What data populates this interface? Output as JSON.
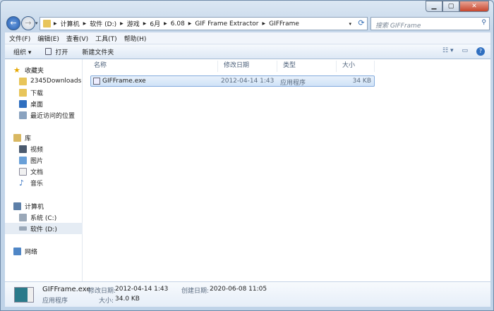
{
  "address": {
    "crumbs": [
      "计算机",
      "软件 (D:)",
      "游戏",
      "6月",
      "6.08",
      "GIF Frame Extractor",
      "GIFFrame"
    ]
  },
  "search": {
    "placeholder": "搜索 GIFFrame"
  },
  "menu": [
    "文件(F)",
    "编辑(E)",
    "查看(V)",
    "工具(T)",
    "帮助(H)"
  ],
  "toolbar": {
    "organize": "组织 ▾",
    "open": "打开",
    "new_folder": "新建文件夹"
  },
  "sidebar": {
    "favorites": "收藏夹",
    "fav_items": [
      "2345Downloads",
      "下载",
      "桌面",
      "最近访问的位置"
    ],
    "libraries": "库",
    "lib_items": [
      "视频",
      "图片",
      "文档",
      "音乐"
    ],
    "computer": "计算机",
    "drives": [
      "系统 (C:)",
      "软件 (D:)"
    ],
    "network": "网络"
  },
  "columns": {
    "name": "名称",
    "date": "修改日期",
    "type": "类型",
    "size": "大小"
  },
  "files": [
    {
      "name": "GIFFrame.exe",
      "date": "2012-04-14 1:43",
      "type": "应用程序",
      "size": "34 KB"
    }
  ],
  "details": {
    "name": "GIFFrame.exe",
    "type": "应用程序",
    "modified_label": "修改日期:",
    "modified": "2012-04-14 1:43",
    "size_label": "大小:",
    "size": "34.0 KB",
    "created_label": "创建日期:",
    "created": "2020-06-08 11:05"
  }
}
